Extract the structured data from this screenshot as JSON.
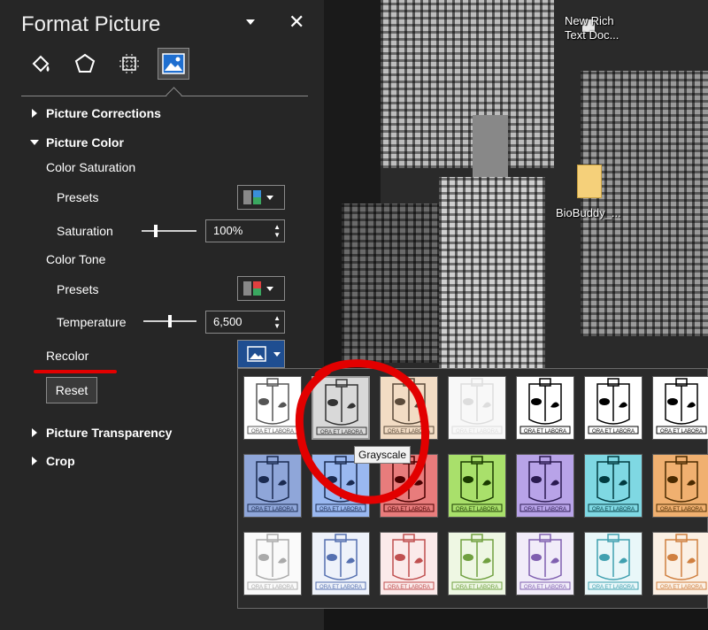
{
  "panel": {
    "title": "Format Picture",
    "tabs": [
      {
        "name": "fill-line-icon"
      },
      {
        "name": "effects-icon"
      },
      {
        "name": "size-properties-icon"
      },
      {
        "name": "picture-icon"
      }
    ],
    "sections": {
      "corrections": "Picture Corrections",
      "color": "Picture Color",
      "transparency": "Picture Transparency",
      "crop": "Crop"
    },
    "color_saturation": {
      "heading": "Color Saturation",
      "presets_label": "Presets",
      "saturation_label": "Saturation",
      "saturation_value": "100%",
      "saturation_level": 0.25
    },
    "color_tone": {
      "heading": "Color Tone",
      "presets_label": "Presets",
      "temperature_label": "Temperature",
      "temperature_value": "6,500",
      "temperature_level": 0.5
    },
    "recolor_label": "Recolor",
    "reset_label": "Reset"
  },
  "desktop": {
    "icon1_label_line1": "New Rich",
    "icon1_label_line2": "Text Doc...",
    "icon2_label": "BioBuddy_..."
  },
  "gallery": {
    "tooltip": "Grayscale",
    "logo_text": "ORA ET LABORA",
    "rows": [
      [
        "#ffffff",
        "#d9d9d9",
        "#f2dcc4",
        "#f8f8f8",
        "#ffffff",
        "#ffffff",
        "#ffffff"
      ],
      [
        "#8fa6d9",
        "#9ab8f0",
        "#e87c7c",
        "#a9e06b",
        "#b8a3e8",
        "#7fd8e3",
        "#f0b070"
      ],
      [
        "#fafafa",
        "#eef2fa",
        "#fbeaea",
        "#eef7e3",
        "#f1ecf9",
        "#e9f7f9",
        "#fbf0e4"
      ]
    ],
    "line_colors": [
      [
        "#555555",
        "#333333",
        "#5a4a3a",
        "#dddddd",
        "#000000",
        "#000000",
        "#000000"
      ],
      [
        "#1a2a50",
        "#1a2a50",
        "#4a0000",
        "#1a3a00",
        "#2a1a50",
        "#003a40",
        "#4a2a00"
      ],
      [
        "#aaaaaa",
        "#5570b0",
        "#c05050",
        "#70a040",
        "#8060b0",
        "#40a0b0",
        "#d08040"
      ]
    ]
  }
}
